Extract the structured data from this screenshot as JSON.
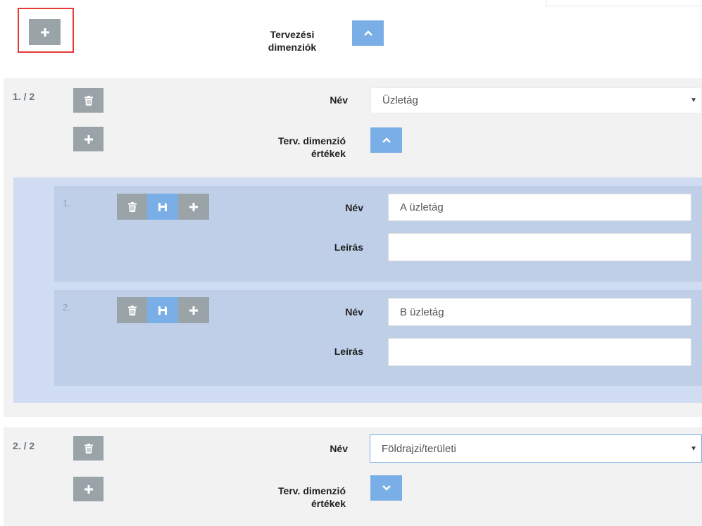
{
  "header": {
    "title": "Tervezési dimenziók"
  },
  "dimensions": [
    {
      "index": "1. / 2",
      "name_label": "Név",
      "name_value": "Üzletág",
      "values_label": "Terv. dimenzió értékek",
      "expanded": true,
      "values": [
        {
          "index": "1.",
          "name_label": "Név",
          "name_value": "A üzletág",
          "desc_label": "Leírás",
          "desc_value": ""
        },
        {
          "index": "2.",
          "name_label": "Név",
          "name_value": "B üzletág",
          "desc_label": "Leírás",
          "desc_value": ""
        }
      ]
    },
    {
      "index": "2. / 2",
      "name_label": "Név",
      "name_value": "Földrajzi/területi",
      "values_label": "Terv. dimenzió értékek",
      "expanded": false
    }
  ],
  "icons": {
    "add": "plus-icon",
    "delete": "trash-icon",
    "save": "floppy-icon",
    "collapse": "chevron-up-icon",
    "expand": "chevron-down-icon"
  },
  "colors": {
    "gray_button": "#9aa4a8",
    "blue_button": "#7aaee6",
    "dimension_bg": "#f2f2f2",
    "values_bg": "#cfdcf1",
    "value_card_bg": "#bfcfe8",
    "highlight": "#e53935"
  }
}
